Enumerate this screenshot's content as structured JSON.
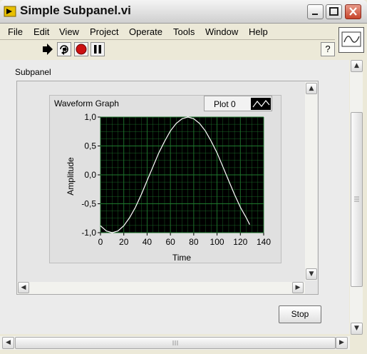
{
  "window": {
    "title": "Simple Subpanel.vi"
  },
  "menu": [
    "File",
    "Edit",
    "View",
    "Project",
    "Operate",
    "Tools",
    "Window",
    "Help"
  ],
  "toolbar": {
    "help_label": "?"
  },
  "subpanel": {
    "label": "Subpanel"
  },
  "graph": {
    "title": "Waveform Graph",
    "legend_label": "Plot 0"
  },
  "stop_button": {
    "label": "Stop"
  },
  "colors": {
    "plot_bg": "#000000",
    "grid": "#1f7a2e",
    "trace": "#ffffff",
    "run_red": "#cc1111"
  },
  "chart_data": {
    "type": "line",
    "title": "Waveform Graph",
    "xlabel": "Time",
    "ylabel": "Amplitude",
    "xlim": [
      0,
      140
    ],
    "ylim": [
      -1.0,
      1.0
    ],
    "x_ticks": [
      "0",
      "20",
      "40",
      "60",
      "80",
      "100",
      "120",
      "140"
    ],
    "y_ticks": [
      "1,0",
      "0,5",
      "0,0",
      "-0,5",
      "-1,0"
    ],
    "grid": true,
    "series": [
      {
        "name": "Plot 0",
        "x": [
          0,
          5,
          10,
          15,
          20,
          25,
          30,
          35,
          40,
          45,
          50,
          55,
          60,
          65,
          70,
          75,
          80,
          85,
          90,
          95,
          100,
          105,
          110,
          115,
          120,
          125,
          128
        ],
        "y": [
          -0.88,
          -0.97,
          -1.0,
          -0.97,
          -0.88,
          -0.74,
          -0.56,
          -0.34,
          -0.1,
          0.14,
          0.38,
          0.58,
          0.76,
          0.89,
          0.97,
          1.0,
          0.97,
          0.89,
          0.76,
          0.58,
          0.38,
          0.14,
          -0.1,
          -0.34,
          -0.56,
          -0.74,
          -0.86
        ]
      }
    ]
  }
}
